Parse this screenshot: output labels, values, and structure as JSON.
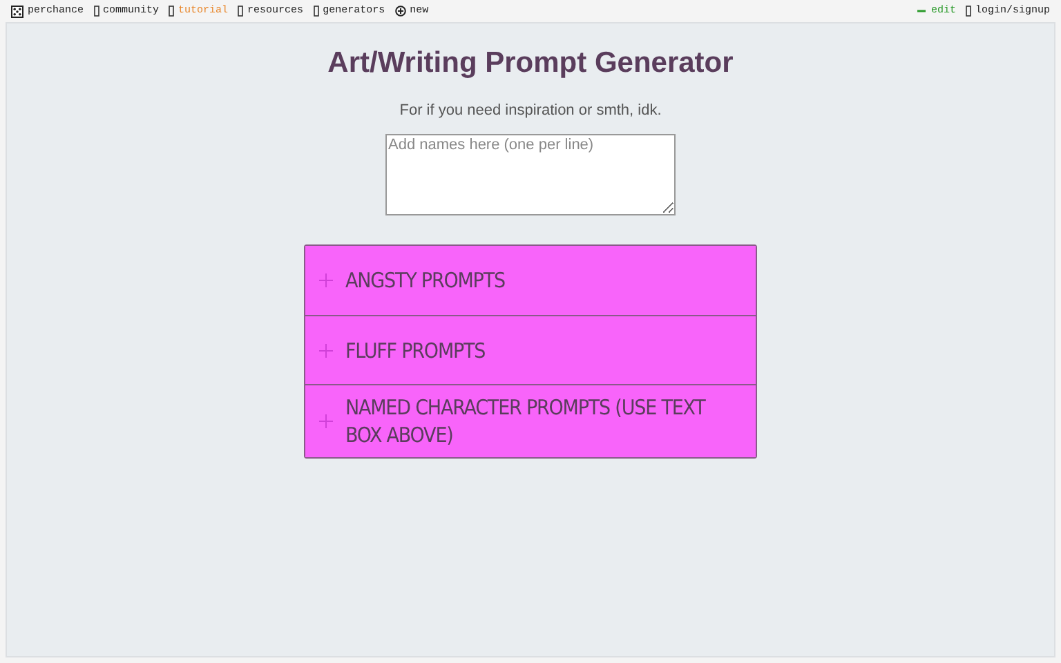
{
  "top_bar": {
    "nav": [
      {
        "label": "perchance",
        "selected": false
      },
      {
        "label": "community",
        "selected": false
      },
      {
        "label": "tutorial",
        "selected": true
      },
      {
        "label": "resources",
        "selected": false
      },
      {
        "label": "generators",
        "selected": false
      },
      {
        "label": "new",
        "selected": false
      }
    ],
    "actions": [
      {
        "label": "edit"
      },
      {
        "label": "login/signup"
      }
    ]
  },
  "title": "Art/Writing Prompt Generator",
  "subtitle": "For if you need inspiration or smth, idk.",
  "names_field": {
    "placeholder": "Add names here (one per line)"
  },
  "accordion": [
    {
      "label": "ANGSTY PROMPTS",
      "expanded": false
    },
    {
      "label": "FLUFF PROMPTS",
      "expanded": false
    },
    {
      "label": "NAMED CHARACTER PROMPTS (USE TEXT BOX ABOVE)",
      "expanded": false
    }
  ]
}
